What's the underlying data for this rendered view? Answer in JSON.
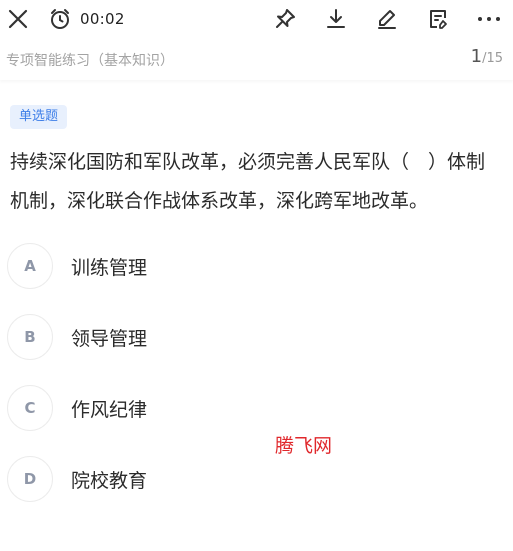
{
  "toolbar": {
    "close_icon": "close-icon",
    "timer_icon": "alarm-clock-icon",
    "timer_text": "00:02",
    "actions": [
      "pin-icon",
      "download-icon",
      "edit-icon",
      "note-icon",
      "more-icon"
    ]
  },
  "header": {
    "section_title": "专项智能练习（基本知识）",
    "current": "1",
    "separator": "/",
    "total": "15"
  },
  "question": {
    "type_label": "单选题",
    "stem": "持续深化国防和军队改革，必须完善人民军队（　）体制机制，深化联合作战体系改革，深化跨军地改革。",
    "options": [
      {
        "letter": "A",
        "text": "训练管理"
      },
      {
        "letter": "B",
        "text": "领导管理"
      },
      {
        "letter": "C",
        "text": "作风纪律"
      },
      {
        "letter": "D",
        "text": "院校教育"
      }
    ]
  },
  "watermark": "腾飞网",
  "colors": {
    "accent": "#3f7fe8",
    "badge_bg": "#e8f0fd",
    "watermark": "#e0272b"
  }
}
